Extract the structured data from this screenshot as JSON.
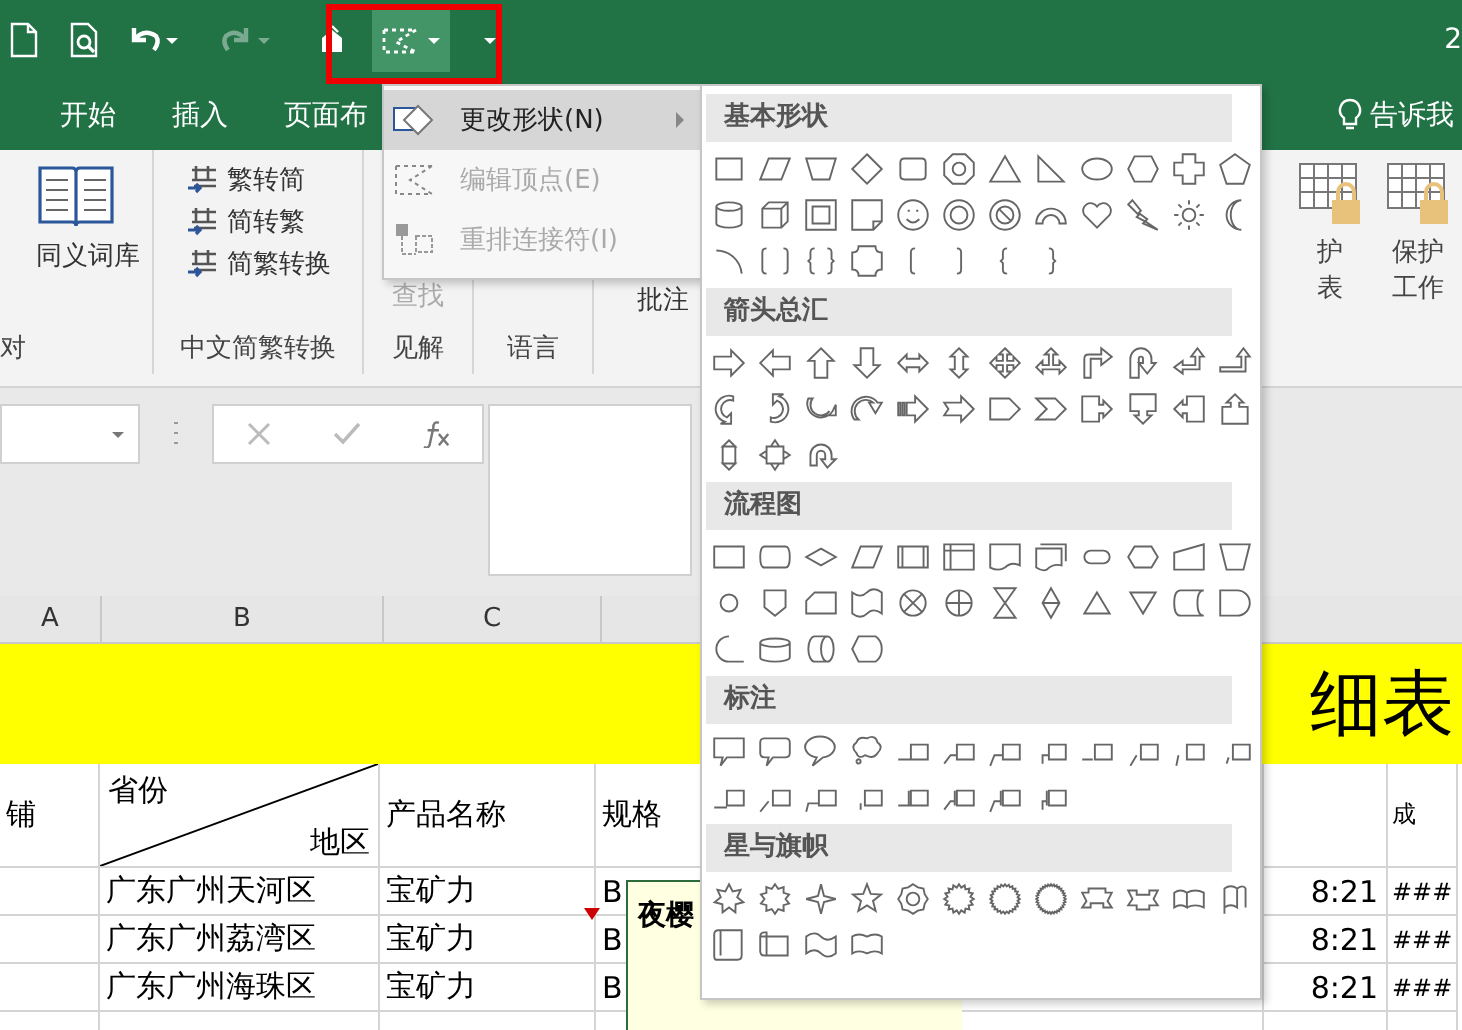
{
  "title_bar": {
    "title_fragment": "2",
    "redo": {
      "disabled": true
    }
  },
  "tabs": [
    {
      "label": "开始",
      "selected": false
    },
    {
      "label": "插入",
      "selected": false
    },
    {
      "label": "页面布",
      "selected": false
    }
  ],
  "tell_me": "告诉我",
  "ribbon": {
    "proofing": {
      "command": "同义词库",
      "group_label": "对"
    },
    "chinese_conversion": {
      "commands": [
        "繁转简",
        "简转繁",
        "简繁转换"
      ],
      "group_label": "中文简繁转换"
    },
    "insights": {
      "command": "查找",
      "disabled": true,
      "group_label": "见解"
    },
    "language": {
      "group_label": "语言"
    },
    "comments": {
      "command": "批注"
    },
    "protect": [
      {
        "line1": "护",
        "line2": "表"
      },
      {
        "line1": "保护",
        "line2": "工作"
      }
    ]
  },
  "columns": [
    "A",
    "B",
    "C"
  ],
  "title_band": "细表",
  "header_row": {
    "column_a": "铺",
    "region_top": "省份",
    "region_bottom": "地区",
    "product": "产品名称",
    "spec": "规格",
    "column_f": "成"
  },
  "rows": [
    {
      "region": "广东广州天河区",
      "product": "宝矿力",
      "spec": "B",
      "time": "8:21",
      "column_f": "###"
    },
    {
      "region": "广东广州荔湾区",
      "product": "宝矿力",
      "spec": "B",
      "time": "8:21",
      "column_f": "###"
    },
    {
      "region": "广东广州海珠区",
      "product": "宝矿力",
      "spec": "B",
      "time": "8:21",
      "column_f": "###"
    }
  ],
  "comment": {
    "author": "夜樱"
  },
  "context_menu": [
    {
      "label": "更改形状(N)",
      "highlighted": true,
      "disabled": false,
      "submenu": true
    },
    {
      "label": "编辑顶点(E)",
      "highlighted": false,
      "disabled": true,
      "submenu": false
    },
    {
      "label": "重排连接符(I)",
      "highlighted": false,
      "disabled": true,
      "submenu": false
    }
  ],
  "shape_gallery": {
    "sections": [
      {
        "title": "基本形状",
        "kind": "basic"
      },
      {
        "title": "箭头总汇",
        "kind": "arrows"
      },
      {
        "title": "流程图",
        "kind": "flowchart"
      },
      {
        "title": "标注",
        "kind": "callouts"
      },
      {
        "title": "星与旗帜",
        "kind": "stars"
      }
    ]
  }
}
